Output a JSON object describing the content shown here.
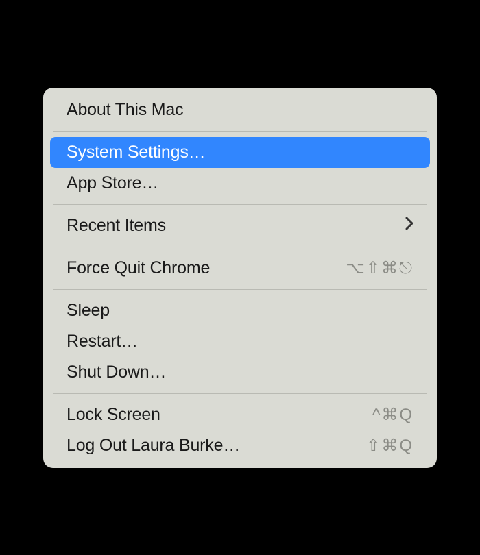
{
  "menu": {
    "items": [
      {
        "label": "About This Mac",
        "shortcut": "",
        "submenu": false,
        "highlighted": false
      },
      {
        "separator": true
      },
      {
        "label": "System Settings…",
        "shortcut": "",
        "submenu": false,
        "highlighted": true
      },
      {
        "label": "App Store…",
        "shortcut": "",
        "submenu": false,
        "highlighted": false
      },
      {
        "separator": true
      },
      {
        "label": "Recent Items",
        "shortcut": "",
        "submenu": true,
        "highlighted": false
      },
      {
        "separator": true
      },
      {
        "label": "Force Quit Chrome",
        "shortcut": "⌥⇧⌘⎋",
        "submenu": false,
        "highlighted": false
      },
      {
        "separator": true
      },
      {
        "label": "Sleep",
        "shortcut": "",
        "submenu": false,
        "highlighted": false
      },
      {
        "label": "Restart…",
        "shortcut": "",
        "submenu": false,
        "highlighted": false
      },
      {
        "label": "Shut Down…",
        "shortcut": "",
        "submenu": false,
        "highlighted": false
      },
      {
        "separator": true
      },
      {
        "label": "Lock Screen",
        "shortcut": "^⌘Q",
        "submenu": false,
        "highlighted": false
      },
      {
        "label": "Log Out Laura Burke…",
        "shortcut": "⇧⌘Q",
        "submenu": false,
        "highlighted": false
      }
    ]
  },
  "colors": {
    "menuBg": "#dadbd4",
    "highlight": "#3186fe"
  }
}
